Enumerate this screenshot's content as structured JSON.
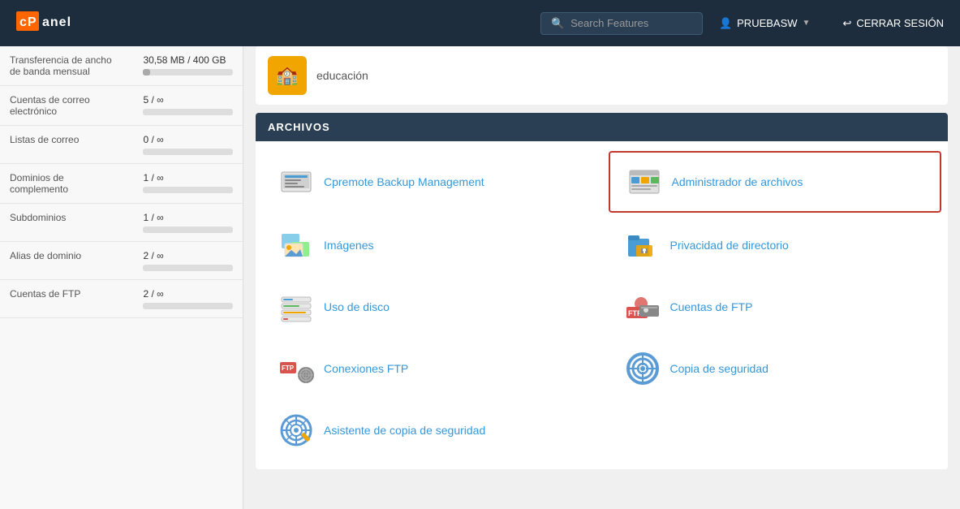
{
  "header": {
    "logo": "cPanel",
    "search_placeholder": "Search Features",
    "user": "PRUEBASW",
    "logout_label": "CERRAR SESIÓN",
    "user_icon": "👤",
    "logout_icon": "↩"
  },
  "sidebar": {
    "rows": [
      {
        "label": "Transferencia de ancho de banda mensual",
        "value": "30,58 MB / 400 GB",
        "has_bar": true,
        "bar_pct": 8
      },
      {
        "label": "Cuentas de correo electrónico",
        "value": "5 / ∞",
        "has_bar": true,
        "bar_pct": 0
      },
      {
        "label": "Listas de correo",
        "value": "0 / ∞",
        "has_bar": true,
        "bar_pct": 0
      },
      {
        "label": "Dominios de complemento",
        "value": "1 / ∞",
        "has_bar": true,
        "bar_pct": 0
      },
      {
        "label": "Subdominios",
        "value": "1 / ∞",
        "has_bar": true,
        "bar_pct": 0
      },
      {
        "label": "Alias de dominio",
        "value": "2 / ∞",
        "has_bar": true,
        "bar_pct": 0
      },
      {
        "label": "Cuentas de FTP",
        "value": "2 / ∞",
        "has_bar": true,
        "bar_pct": 0
      }
    ]
  },
  "top_card": {
    "label": "educación",
    "icon": "🏫"
  },
  "archivos_section": {
    "header": "ARCHIVOS",
    "features": [
      {
        "id": "cpremote",
        "label": "Cpremote Backup Management",
        "highlighted": false
      },
      {
        "id": "file-manager",
        "label": "Administrador de archivos",
        "highlighted": true
      },
      {
        "id": "images",
        "label": "Imágenes",
        "highlighted": false
      },
      {
        "id": "dir-privacy",
        "label": "Privacidad de directorio",
        "highlighted": false
      },
      {
        "id": "disk-usage",
        "label": "Uso de disco",
        "highlighted": false
      },
      {
        "id": "ftp-accounts",
        "label": "Cuentas de FTP",
        "highlighted": false
      },
      {
        "id": "ftp-connections",
        "label": "Conexiones FTP",
        "highlighted": false
      },
      {
        "id": "backup",
        "label": "Copia de seguridad",
        "highlighted": false
      },
      {
        "id": "backup-wizard",
        "label": "Asistente de copia de seguridad",
        "highlighted": false
      }
    ]
  }
}
